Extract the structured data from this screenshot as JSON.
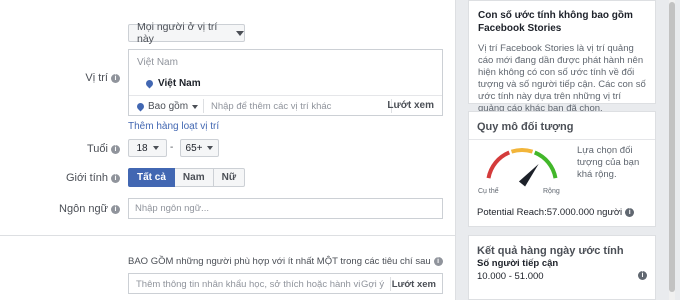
{
  "audience": {
    "location_mode_label": "Mọi người ở vị trí này",
    "location_label": "Vị trí",
    "country_header": "Việt Nam",
    "selected_location": "Việt Nam",
    "include_label": "Bao gồm",
    "location_placeholder": "Nhập để thêm các vị trí khác",
    "browse_label": "Lướt xem",
    "bulk_locations_link": "Thêm hàng loạt vị trí",
    "age_label": "Tuổi",
    "age_min": "18",
    "age_max": "65+",
    "age_separator": "-",
    "gender_label": "Giới tính",
    "genders": [
      "Tất cả",
      "Nam",
      "Nữ"
    ],
    "selected_gender": "Tất cả",
    "language_label": "Ngôn ngữ",
    "language_placeholder": "Nhập ngôn ngữ...",
    "detailed_include_title": "BAO GỒM những người phù hợp với ít nhất MỘT trong các tiêu chí sau",
    "detailed_placeholder": "Thêm thông tin nhân khẩu học, sở thích hoặc hành vi",
    "suggestions_label": "Gợi ý",
    "detailed_browse_label": "Lướt xem"
  },
  "stories_notice": {
    "title": "Con số ước tính không bao gồm Facebook Stories",
    "body": "Vị trí Facebook Stories là vị trí quảng cáo mới đang dần được phát hành nên hiện không có con số ước tính về đối tượng và số người tiếp cận. Các con số ước tính này dựa trên những vị trí quảng cáo khác bạn đã chọn."
  },
  "audience_size": {
    "title": "Quy mô đối tượng",
    "gauge_left": "Cụ thể",
    "gauge_right": "Rộng",
    "description": "Lựa chọn đối tượng của bạn khá rộng.",
    "potential_reach": "Potential Reach:57.000.000 người",
    "needle_fraction": 0.72,
    "colors": {
      "red": "#d43b3b",
      "yellow": "#f2b53a",
      "green": "#42b72a"
    }
  },
  "daily_results": {
    "title": "Kết quả hàng ngày ước tính",
    "reach_label": "Số người tiếp cận",
    "reach_value": "10.000 - 51.000"
  },
  "theme": {
    "accent": "#4267b2"
  }
}
